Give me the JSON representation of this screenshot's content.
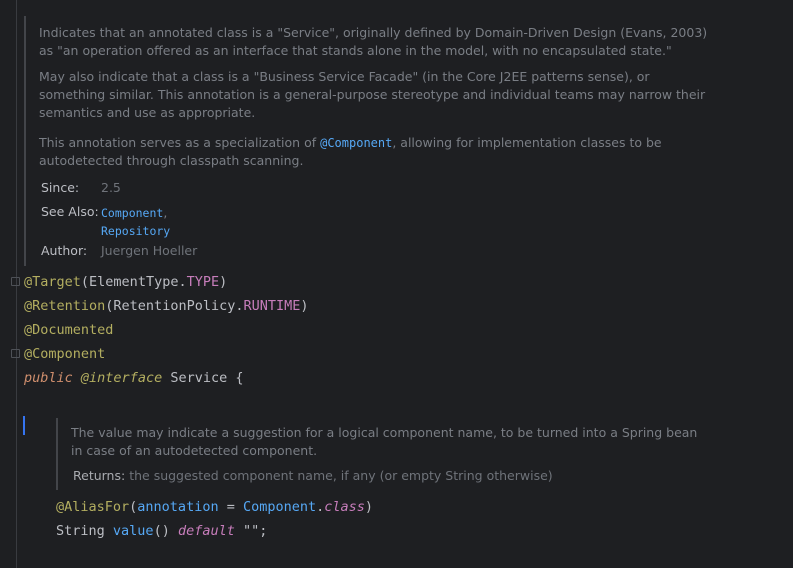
{
  "doc_main": {
    "para1": [
      "Indicates that an annotated class is a \"Service\", originally defined by Domain-Driven Design (Evans, 2003)",
      "as \"an operation offered as an interface that stands alone in the model, with no encapsulated state.\""
    ],
    "para2": [
      "May also indicate that a class is a \"Business Service Facade\" (in the Core J2EE patterns sense), or",
      "something similar. This annotation is a general-purpose stereotype and individual teams may narrow their",
      "semantics and use as appropriate."
    ],
    "para3_prefix": "This annotation serves as a specialization of ",
    "para3_link": "@Component",
    "para3_suffix": ", allowing for implementation classes to be",
    "para3_line2": "autodetected through classpath scanning.",
    "since_label": "Since:",
    "since_value": "2.5",
    "see_also_label": "See Also:",
    "see_also_1": "Component",
    "see_also_1_sep": ",",
    "see_also_2": "Repository",
    "author_label": "Author:",
    "author_value": "Juergen Hoeller"
  },
  "code": {
    "line1_ann": "@Target",
    "line1_open": "(",
    "line1_type": "ElementType",
    "line1_dot": ".",
    "line1_const": "TYPE",
    "line1_close": ")",
    "line2_ann": "@Retention",
    "line2_open": "(",
    "line2_type": "RetentionPolicy",
    "line2_dot": ".",
    "line2_const": "RUNTIME",
    "line2_close": ")",
    "line3_ann": "@Documented",
    "line4_ann": "@Component",
    "line5_kw": "public",
    "line5_iface": "@interface",
    "line5_name": "Service",
    "line5_brace": "{",
    "alias_ann": "@AliasFor",
    "alias_open": "(",
    "alias_param": "annotation",
    "alias_eq": " = ",
    "alias_type": "Component",
    "alias_dot": ".",
    "alias_kw": "class",
    "alias_close": ")",
    "value_type": "String",
    "value_method": "value",
    "value_parens": "()",
    "value_default": "default",
    "value_str": "\"\"",
    "value_semi": ";"
  },
  "doc_inner": {
    "para1": [
      "The value may indicate a suggestion for a logical component name, to be turned into a Spring bean",
      "in case of an autodetected component."
    ],
    "returns_label": "Returns:",
    "returns_value": "the suggested component name, if any (or empty String otherwise)"
  }
}
